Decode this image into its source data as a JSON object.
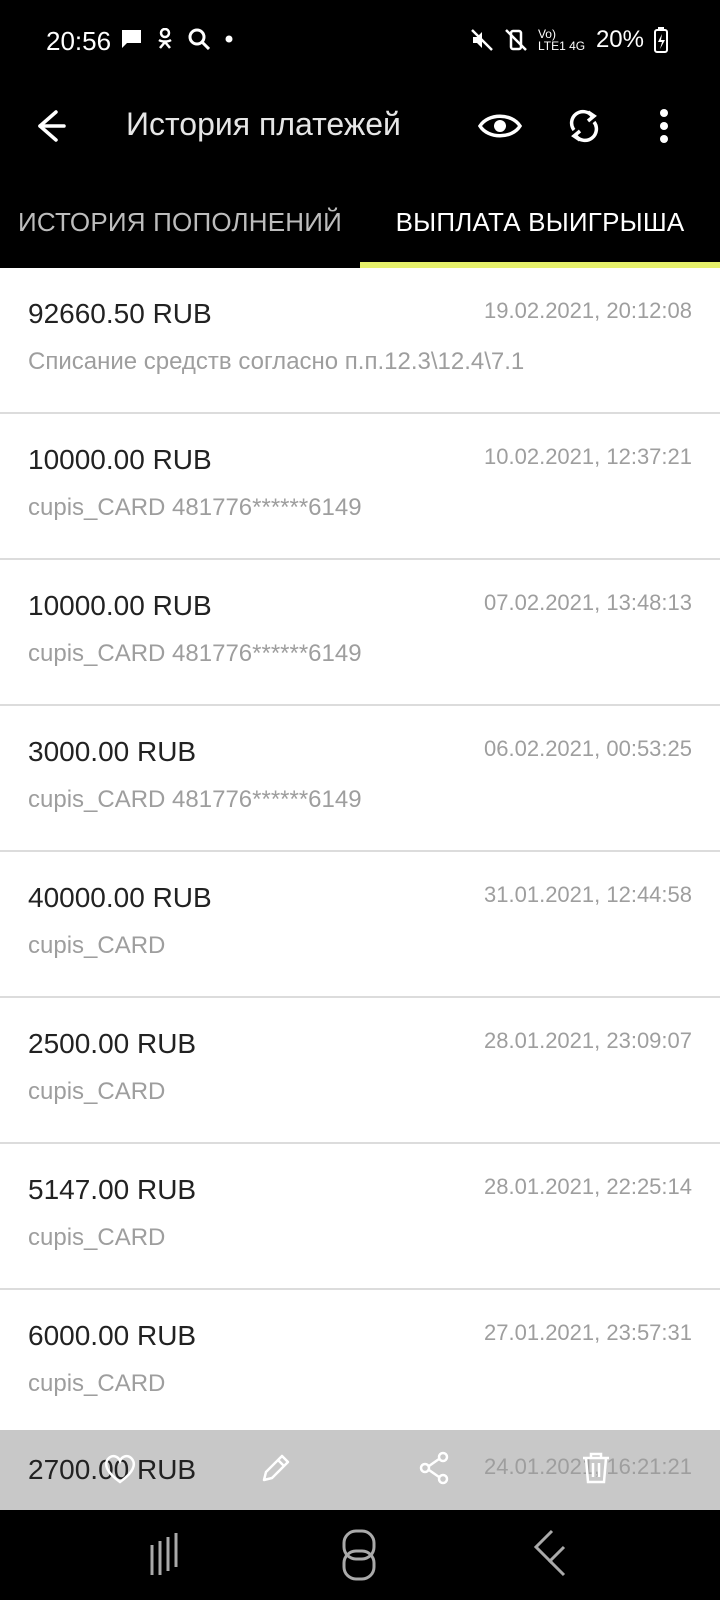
{
  "status": {
    "time": "20:56",
    "signal_text": "Vo) LTE1 4G",
    "battery": "20%"
  },
  "header": {
    "title": "История платежей"
  },
  "tabs": [
    {
      "label": "ИСТОРИЯ ПОПОЛНЕНИЙ"
    },
    {
      "label": "ВЫПЛАТА ВЫИГРЫША"
    }
  ],
  "payments": [
    {
      "amount": "92660.50 RUB",
      "date": "19.02.2021, 20:12:08",
      "desc": "Списание средств согласно п.п.12.3\\12.4\\7.1"
    },
    {
      "amount": "10000.00 RUB",
      "date": "10.02.2021, 12:37:21",
      "desc": "cupis_CARD 481776******6149"
    },
    {
      "amount": "10000.00 RUB",
      "date": "07.02.2021, 13:48:13",
      "desc": "cupis_CARD 481776******6149"
    },
    {
      "amount": "3000.00 RUB",
      "date": "06.02.2021, 00:53:25",
      "desc": "cupis_CARD 481776******6149"
    },
    {
      "amount": "40000.00 RUB",
      "date": "31.01.2021, 12:44:58",
      "desc": "cupis_CARD"
    },
    {
      "amount": "2500.00 RUB",
      "date": "28.01.2021, 23:09:07",
      "desc": "cupis_CARD"
    },
    {
      "amount": "5147.00 RUB",
      "date": "28.01.2021, 22:25:14",
      "desc": "cupis_CARD"
    },
    {
      "amount": "6000.00 RUB",
      "date": "27.01.2021, 23:57:31",
      "desc": "cupis_CARD"
    }
  ],
  "partial_row": {
    "amount": "2700.00 RUB",
    "date": "24.01.2021, 16:21:21"
  },
  "icons": {
    "back": "back-arrow-icon",
    "eye": "eye-icon",
    "refresh": "refresh-icon",
    "more": "more-vert-icon",
    "heart": "heart-icon",
    "edit": "edit-icon",
    "share": "share-icon",
    "trash": "trash-icon"
  },
  "colors": {
    "appbar": "#000000",
    "tab_indicator": "#e6f06b",
    "muted_text": "#9e9e9e"
  }
}
